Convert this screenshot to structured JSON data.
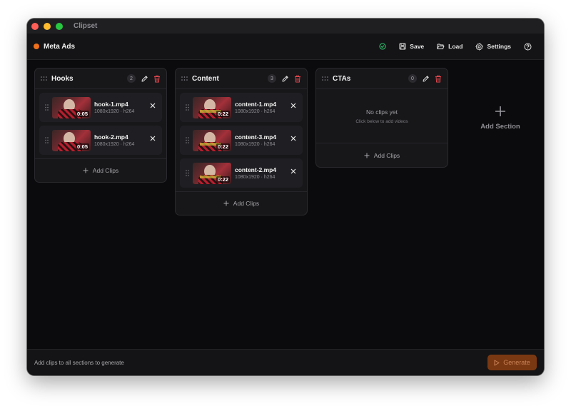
{
  "app": {
    "title": "Clipset"
  },
  "colors": {
    "close": "#ff5f57",
    "minimize": "#febc2e",
    "maximize": "#28c840",
    "project_dot": "#f0711c",
    "status_ok": "#2ecc71",
    "delete": "#e5484d",
    "generate_bg": "#7a3812"
  },
  "header": {
    "project_name": "Meta Ads",
    "status_icon": "check-circle-icon",
    "save_label": "Save",
    "load_label": "Load",
    "settings_label": "Settings",
    "help_icon": "help-circle-icon"
  },
  "sections": [
    {
      "title": "Hooks",
      "count": "2",
      "clips": [
        {
          "name": "hook-1.mp4",
          "info": "1080x1920 · h264",
          "duration": "0:05"
        },
        {
          "name": "hook-2.mp4",
          "info": "1080x1920 · h264",
          "duration": "0:05"
        }
      ],
      "add_label": "Add Clips"
    },
    {
      "title": "Content",
      "count": "3",
      "clips": [
        {
          "name": "content-1.mp4",
          "info": "1080x1920 · h264",
          "duration": "0:22"
        },
        {
          "name": "content-3.mp4",
          "info": "1080x1920 · h264",
          "duration": "0:22"
        },
        {
          "name": "content-2.mp4",
          "info": "1080x1920 · h264",
          "duration": "0:22"
        }
      ],
      "add_label": "Add Clips"
    },
    {
      "title": "CTAs",
      "count": "0",
      "clips": [],
      "empty_title": "No clips yet",
      "empty_sub": "Click below to add videos",
      "add_label": "Add Clips"
    }
  ],
  "add_section": {
    "label": "Add Section"
  },
  "footer": {
    "message": "Add clips to all sections to generate",
    "generate_label": "Generate"
  }
}
